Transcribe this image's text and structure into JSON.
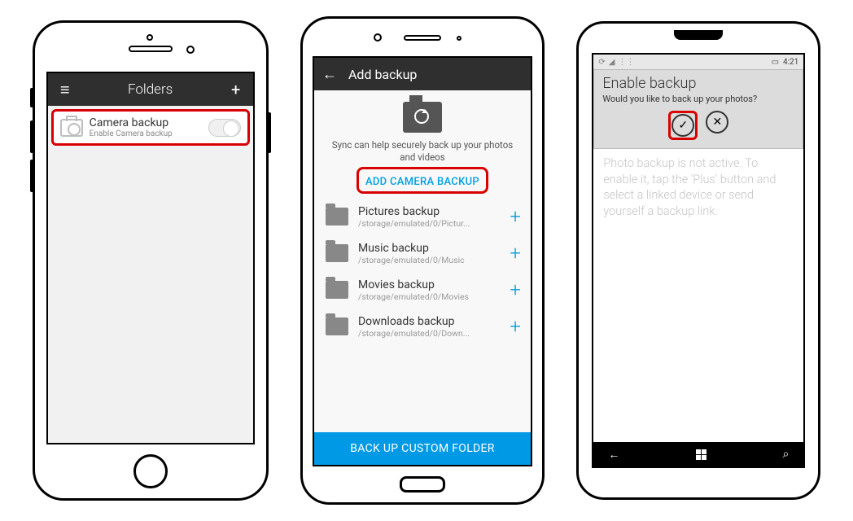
{
  "ios": {
    "header_title": "Folders",
    "row": {
      "title": "Camera backup",
      "subtitle": "Enable Camera backup"
    }
  },
  "android": {
    "header_title": "Add backup",
    "hero_text": "Sync can help securely back up your photos and videos",
    "add_camera_label": "ADD CAMERA BACKUP",
    "items": [
      {
        "title": "Pictures backup",
        "path": "/storage/emulated/0/Pictur..."
      },
      {
        "title": "Music backup",
        "path": "/storage/emulated/0/Music"
      },
      {
        "title": "Movies backup",
        "path": "/storage/emulated/0/Movies"
      },
      {
        "title": "Downloads backup",
        "path": "/storage/emulated/0/Down..."
      }
    ],
    "footer_label": "BACK UP CUSTOM FOLDER"
  },
  "wp": {
    "status_time": "4:21",
    "dialog_title": "Enable backup",
    "dialog_message": "Would you like to back up your photos?",
    "body_text": "Photo backup is not active. To enable it, tap the 'Plus' button and select a linked device or send yourself a backup link."
  }
}
